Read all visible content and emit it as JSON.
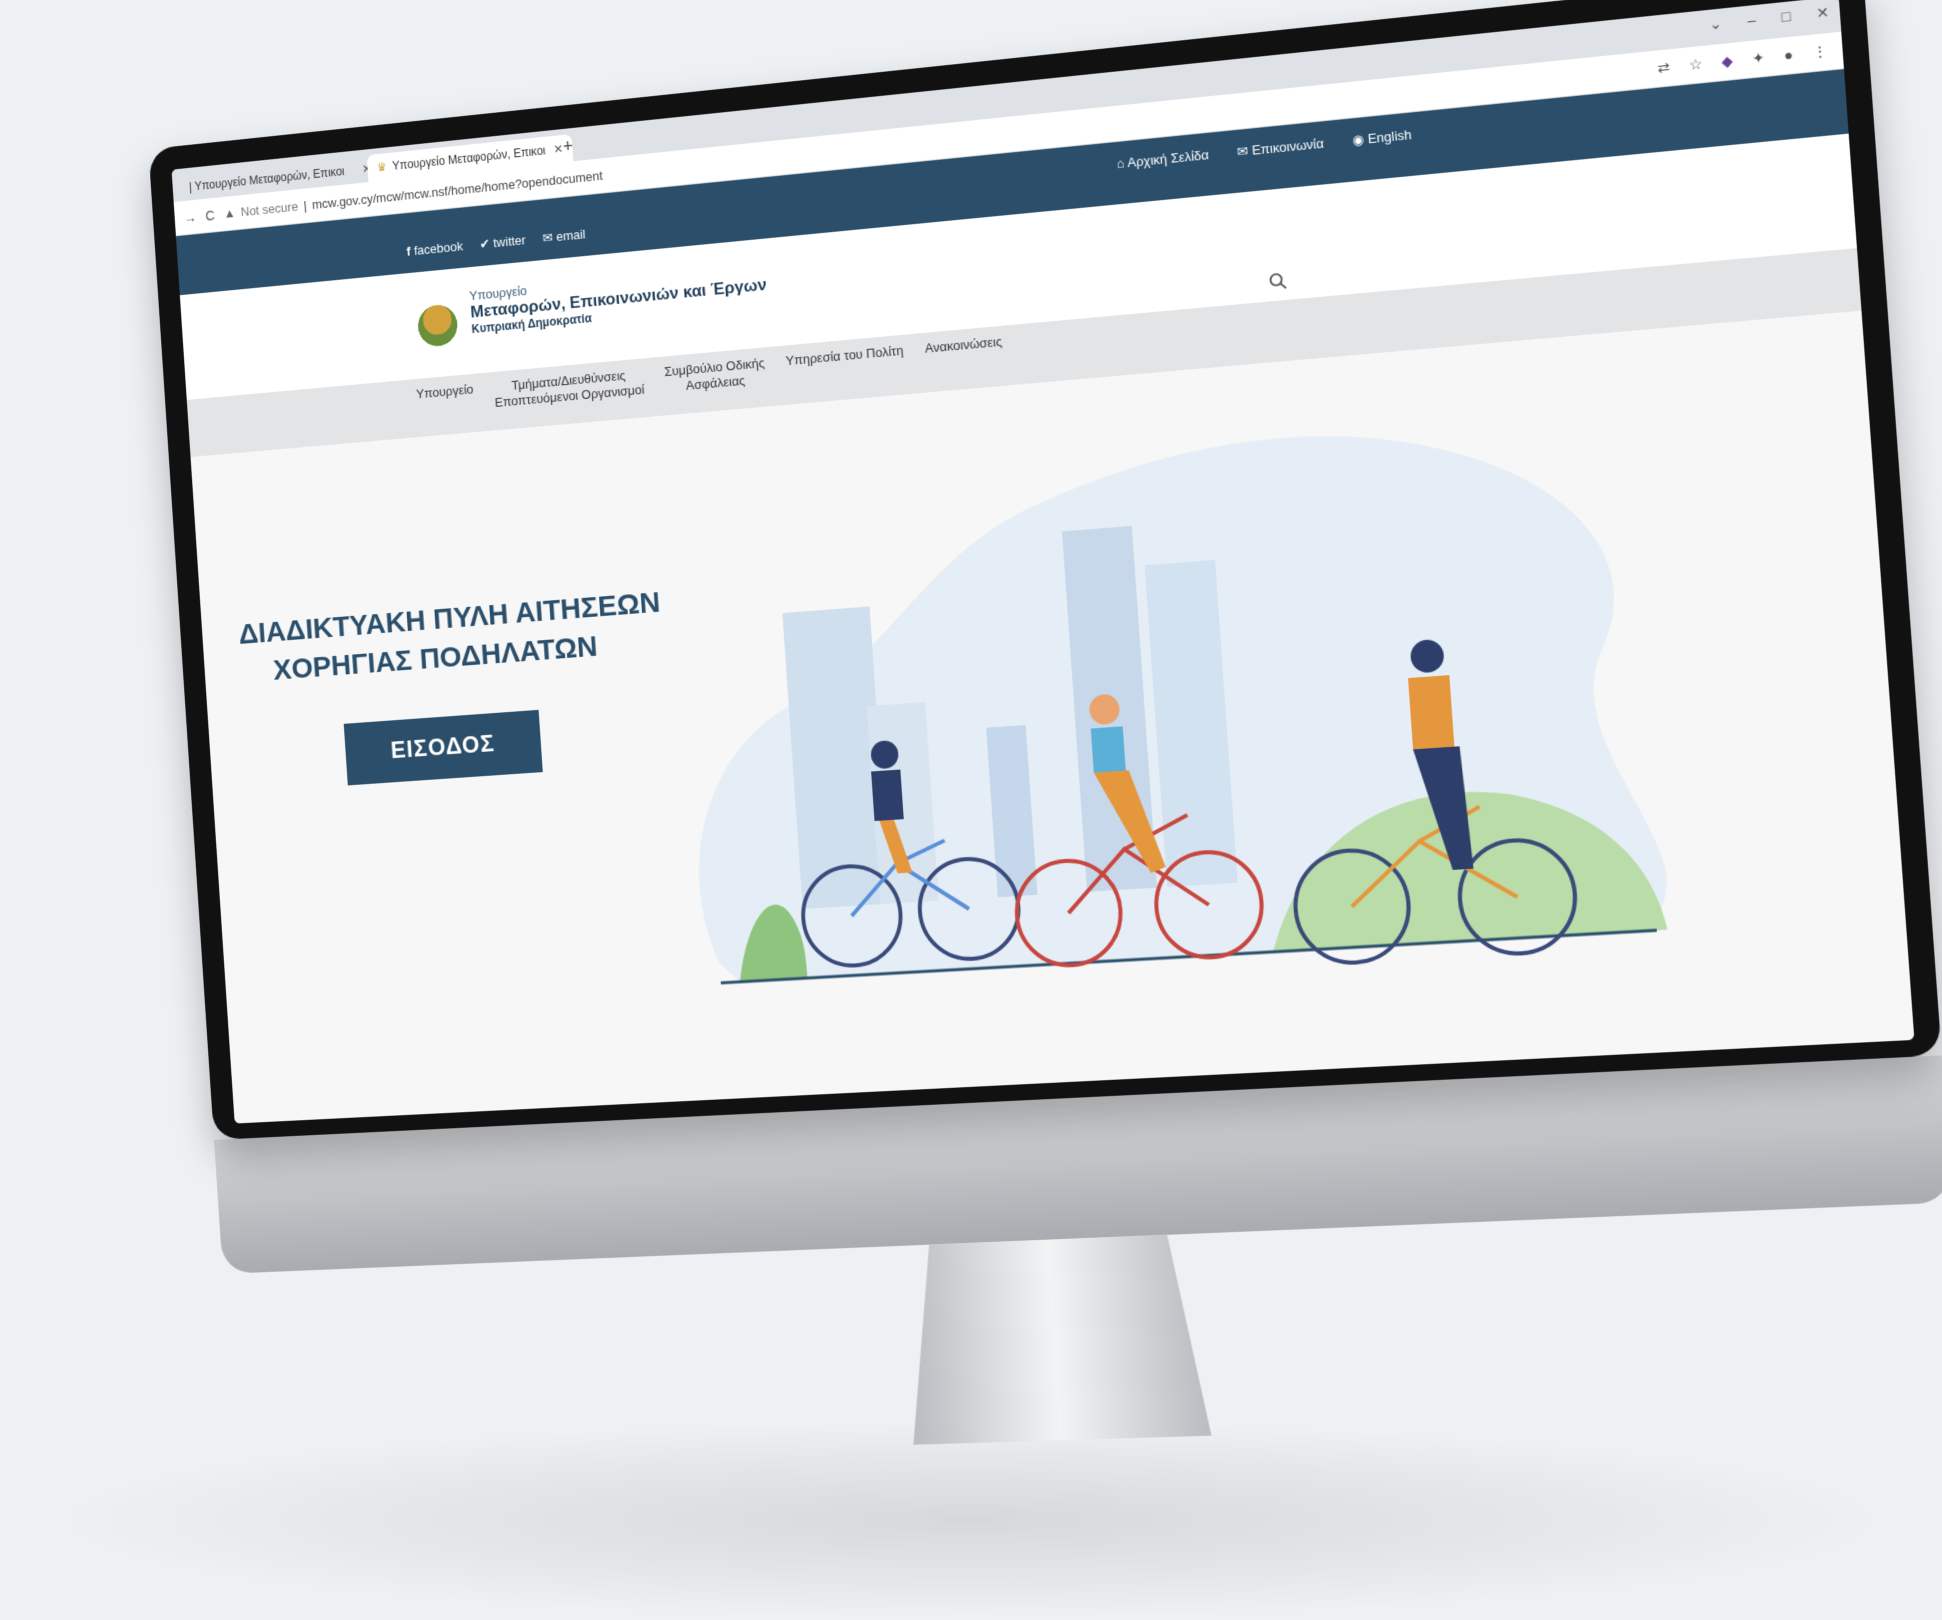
{
  "browser": {
    "tabs": [
      {
        "label": "| Υπουργείο Μεταφορών, Επικοι"
      },
      {
        "label": "Υπουργείο Μεταφορών, Επικοι"
      }
    ],
    "security_label": "Not secure",
    "url": "mcw.gov.cy/mcw/mcw.nsf/home/home?opendocument"
  },
  "site": {
    "social": [
      "facebook",
      "twitter",
      "email"
    ],
    "top_links": [
      "Αρχική Σελίδα",
      "Επικοινωνία",
      "English"
    ],
    "logo": {
      "line1": "Υπουργείο",
      "line2": "Μεταφορών, Επικοινωνιών και Έργων",
      "line3": "Κυπριακή Δημοκρατία"
    },
    "menu": [
      {
        "line1": "Υπουργείο",
        "line2": ""
      },
      {
        "line1": "Τμήματα/Διευθύνσεις",
        "line2": "Εποπτευόμενοι Οργανισμοί"
      },
      {
        "line1": "Συμβούλιο Οδικής",
        "line2": "Ασφάλειας"
      },
      {
        "line1": "Υπηρεσία του Πολίτη",
        "line2": ""
      },
      {
        "line1": "Ανακοινώσεις",
        "line2": ""
      }
    ]
  },
  "hero": {
    "title_line1": "ΔΙΑΔΙΚΤΥΑΚΗ ΠΥΛΗ ΑΙΤΗΣΕΩΝ",
    "title_line2": "ΧΟΡΗΓΙΑΣ ΠΟΔΗΛΑΤΩΝ",
    "button_label": "ΕΙΣΟΔΟΣ"
  },
  "colors": {
    "brand": "#2b4f6b",
    "hero_bg": "#f7f7f7",
    "menu_bg": "#e3e4e6"
  }
}
